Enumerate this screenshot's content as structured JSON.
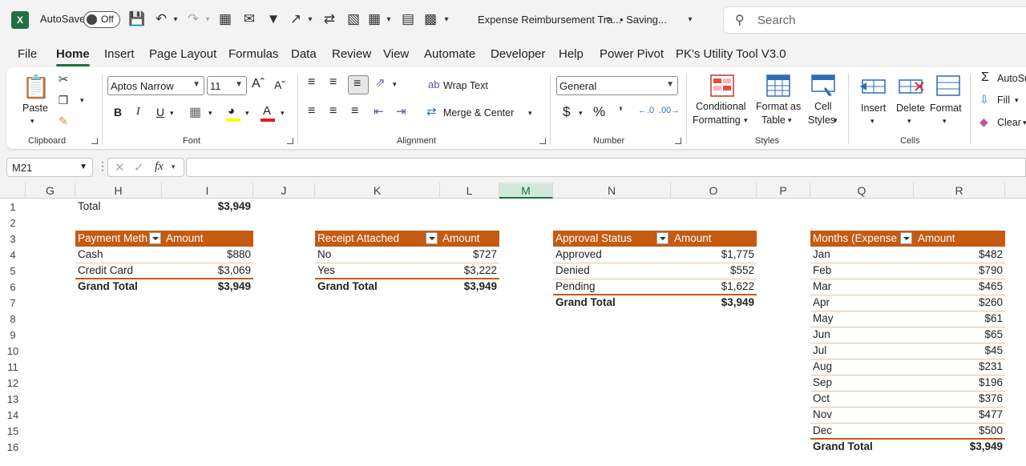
{
  "titlebar": {
    "autosave_label": "AutoSave",
    "autosave_state": "Off",
    "doc_title": "Expense Reimbursement Tra...",
    "saving_status": "• Saving...",
    "search_placeholder": "Search"
  },
  "menu": [
    "File",
    "Home",
    "Insert",
    "Page Layout",
    "Formulas",
    "Data",
    "Review",
    "View",
    "Automate",
    "Developer",
    "Help",
    "Power Pivot",
    "PK's Utility Tool V3.0"
  ],
  "ribbon": {
    "clipboard": {
      "label": "Clipboard",
      "paste": "Paste"
    },
    "font": {
      "label": "Font",
      "font_name": "Aptos Narrow",
      "font_size": "11"
    },
    "alignment": {
      "label": "Alignment",
      "wrap_text": "Wrap Text",
      "merge_center": "Merge & Center"
    },
    "number": {
      "label": "Number",
      "format": "General"
    },
    "styles": {
      "label": "Styles",
      "conditional_1": "Conditional",
      "conditional_2": "Formatting",
      "format_table_1": "Format as",
      "format_table_2": "Table",
      "cell_styles_1": "Cell",
      "cell_styles_2": "Styles"
    },
    "cells": {
      "label": "Cells",
      "insert": "Insert",
      "delete": "Delete",
      "format": "Format"
    },
    "editing": {
      "autosum": "AutoSum",
      "fill": "Fill",
      "clear": "Clear"
    }
  },
  "formula_bar": {
    "name_box": "M21",
    "formula": ""
  },
  "columns": [
    "G",
    "H",
    "I",
    "J",
    "K",
    "L",
    "M",
    "N",
    "O",
    "P",
    "Q",
    "R"
  ],
  "selected_column": "M",
  "rows": [
    "1",
    "2",
    "3",
    "4",
    "5",
    "6",
    "7",
    "8",
    "9",
    "10",
    "11",
    "12",
    "13",
    "14",
    "15",
    "16"
  ],
  "total_cell": {
    "label": "Total",
    "value": "$3,949"
  },
  "pivots": {
    "payment": {
      "header": [
        "Payment Meth",
        "Amount"
      ],
      "rows": [
        [
          "Cash",
          "$880"
        ],
        [
          "Credit Card",
          "$3,069"
        ]
      ],
      "total": [
        "Grand Total",
        "$3,949"
      ]
    },
    "receipt": {
      "header": [
        "Receipt Attached",
        "Amount"
      ],
      "rows": [
        [
          "No",
          "$727"
        ],
        [
          "Yes",
          "$3,222"
        ]
      ],
      "total": [
        "Grand Total",
        "$3,949"
      ]
    },
    "approval": {
      "header": [
        "Approval Status",
        "Amount"
      ],
      "rows": [
        [
          "Approved",
          "$1,775"
        ],
        [
          "Denied",
          "$552"
        ],
        [
          "Pending",
          "$1,622"
        ]
      ],
      "total": [
        "Grand Total",
        "$3,949"
      ]
    },
    "months": {
      "header": [
        "Months (Expense I",
        "Amount"
      ],
      "rows": [
        [
          "Jan",
          "$482"
        ],
        [
          "Feb",
          "$790"
        ],
        [
          "Mar",
          "$465"
        ],
        [
          "Apr",
          "$260"
        ],
        [
          "May",
          "$61"
        ],
        [
          "Jun",
          "$65"
        ],
        [
          "Jul",
          "$45"
        ],
        [
          "Aug",
          "$231"
        ],
        [
          "Sep",
          "$196"
        ],
        [
          "Oct",
          "$376"
        ],
        [
          "Nov",
          "$477"
        ],
        [
          "Dec",
          "$500"
        ]
      ],
      "total": [
        "Grand Total",
        "$3,949"
      ]
    }
  },
  "colors": {
    "pivot_header": "#c55a11",
    "excel_green": "#1e7145"
  }
}
